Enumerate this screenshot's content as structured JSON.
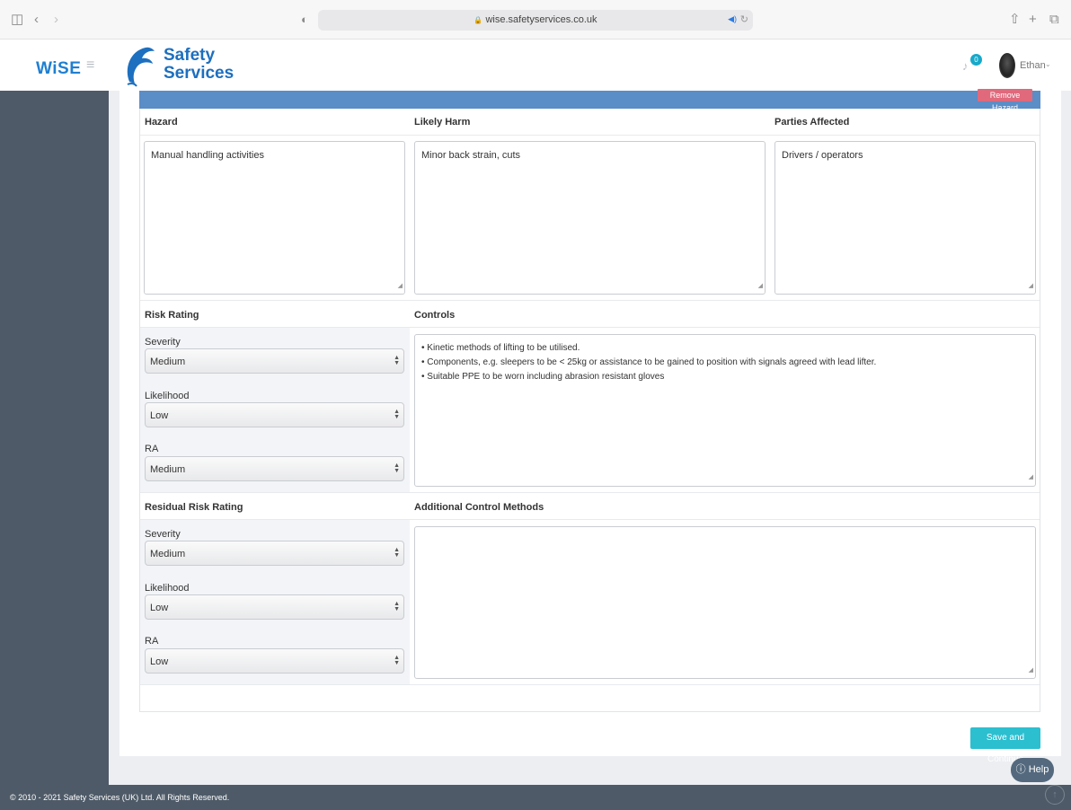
{
  "browser": {
    "url": "wise.safetyservices.co.uk",
    "lock_glyph": "🔒",
    "icons": [
      "sidebar-icon",
      "back-icon",
      "forward-icon",
      "shield-icon",
      "share-icon",
      "new-tab-icon",
      "tabs-icon"
    ]
  },
  "header": {
    "app_logo": "WiSE",
    "brand_line1": "Safety",
    "brand_line2": "Services",
    "notification_count": "0",
    "user_name": "Ethan"
  },
  "hazard": {
    "remove_label": "Remove Hazard",
    "hazard_label": "Hazard",
    "hazard_value": "Manual handling activities",
    "harm_label": "Likely Harm",
    "harm_value": "Minor back strain, cuts",
    "parties_label": "Parties Affected",
    "parties_value": "Drivers / operators"
  },
  "risk": {
    "title": "Risk Rating",
    "severity_label": "Severity",
    "severity_value": "Medium",
    "likelihood_label": "Likelihood",
    "likelihood_value": "Low",
    "ra_label": "RA",
    "ra_value": "Medium"
  },
  "controls": {
    "title": "Controls",
    "lines": [
      "• Kinetic methods of lifting to be utilised.",
      "• Components, e.g. sleepers to be < 25kg or assistance to be gained to position with signals agreed with lead lifter.",
      "• Suitable PPE to be worn including abrasion resistant gloves"
    ]
  },
  "residual": {
    "title": "Residual Risk Rating",
    "severity_label": "Severity",
    "severity_value": "Medium",
    "likelihood_label": "Likelihood",
    "likelihood_value": "Low",
    "ra_label": "RA",
    "ra_value": "Low"
  },
  "additional": {
    "title": "Additional Control Methods",
    "value": ""
  },
  "actions": {
    "save_label": "Save and Continue",
    "help_label": "Help"
  },
  "footer": {
    "copyright": "© 2010 - 2021 Safety Services (UK) Ltd. All Rights Reserved."
  },
  "colors": {
    "sidebar": "#4e5a67",
    "panel_header": "#5b8dc6",
    "remove_button": "#e0697c",
    "save_button": "#2bbfd0",
    "brand": "#1d6fbf"
  }
}
